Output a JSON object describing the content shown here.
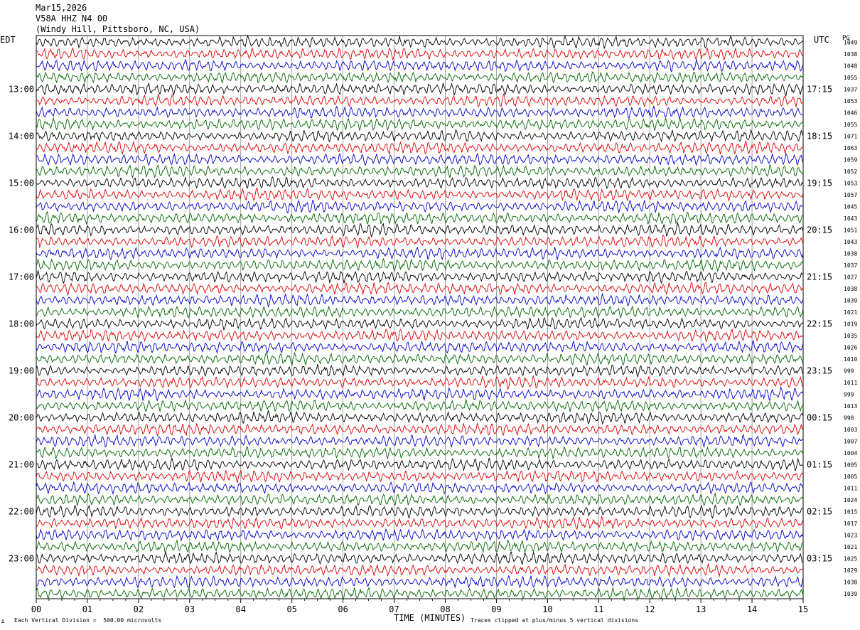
{
  "header": {
    "date": "Mar15,2026",
    "channel": "V58A HHZ N4 00",
    "station": "(Windy Hill, Pittsboro, NC, USA)"
  },
  "left_tz": "EDT",
  "right_tz": "UTC",
  "pg_label": "PG",
  "footer": {
    "corner_mark": "∆",
    "vertical_division": "Each Vertical Division =  500.00 microvolts",
    "clip_note": "Traces clipped at plus/minus 5 vertical divisions"
  },
  "chart_data": {
    "type": "line",
    "xlabel": "TIME (MINUTES)",
    "xlim": [
      0,
      15
    ],
    "x_ticks": [
      "00",
      "01",
      "02",
      "03",
      "04",
      "05",
      "06",
      "07",
      "08",
      "09",
      "10",
      "11",
      "12",
      "13",
      "14",
      "15"
    ],
    "trace_colors": [
      "#000000",
      "#dd0000",
      "#0000cc",
      "#006600"
    ],
    "left_hour_labels": [
      "13:00",
      "14:00",
      "15:00",
      "16:00",
      "17:00",
      "18:00",
      "19:00",
      "20:00",
      "21:00",
      "22:00",
      "23:00"
    ],
    "right_hour_labels": [
      "17:15",
      "18:15",
      "19:15",
      "20:15",
      "21:15",
      "22:15",
      "23:15",
      "00:15",
      "01:15",
      "02:15",
      "03:15"
    ],
    "trace_values": [
      "1049",
      "1038",
      "1048",
      "1055",
      "1037",
      "1053",
      "1046",
      "1055",
      "1071",
      "1063",
      "1059",
      "1052",
      "1053",
      "1057",
      "1045",
      "1043",
      "1051",
      "1043",
      "1038",
      "1037",
      "1027",
      "1038",
      "1039",
      "1021",
      "1019",
      "1035",
      "1026",
      "1010",
      "999",
      "1011",
      "999",
      "1013",
      "998",
      "1003",
      "1007",
      "1004",
      "1005",
      "1005",
      "1011",
      "1024",
      "1015",
      "1017",
      "1023",
      "1021",
      "1025",
      "1029",
      "1038",
      "1039"
    ]
  }
}
